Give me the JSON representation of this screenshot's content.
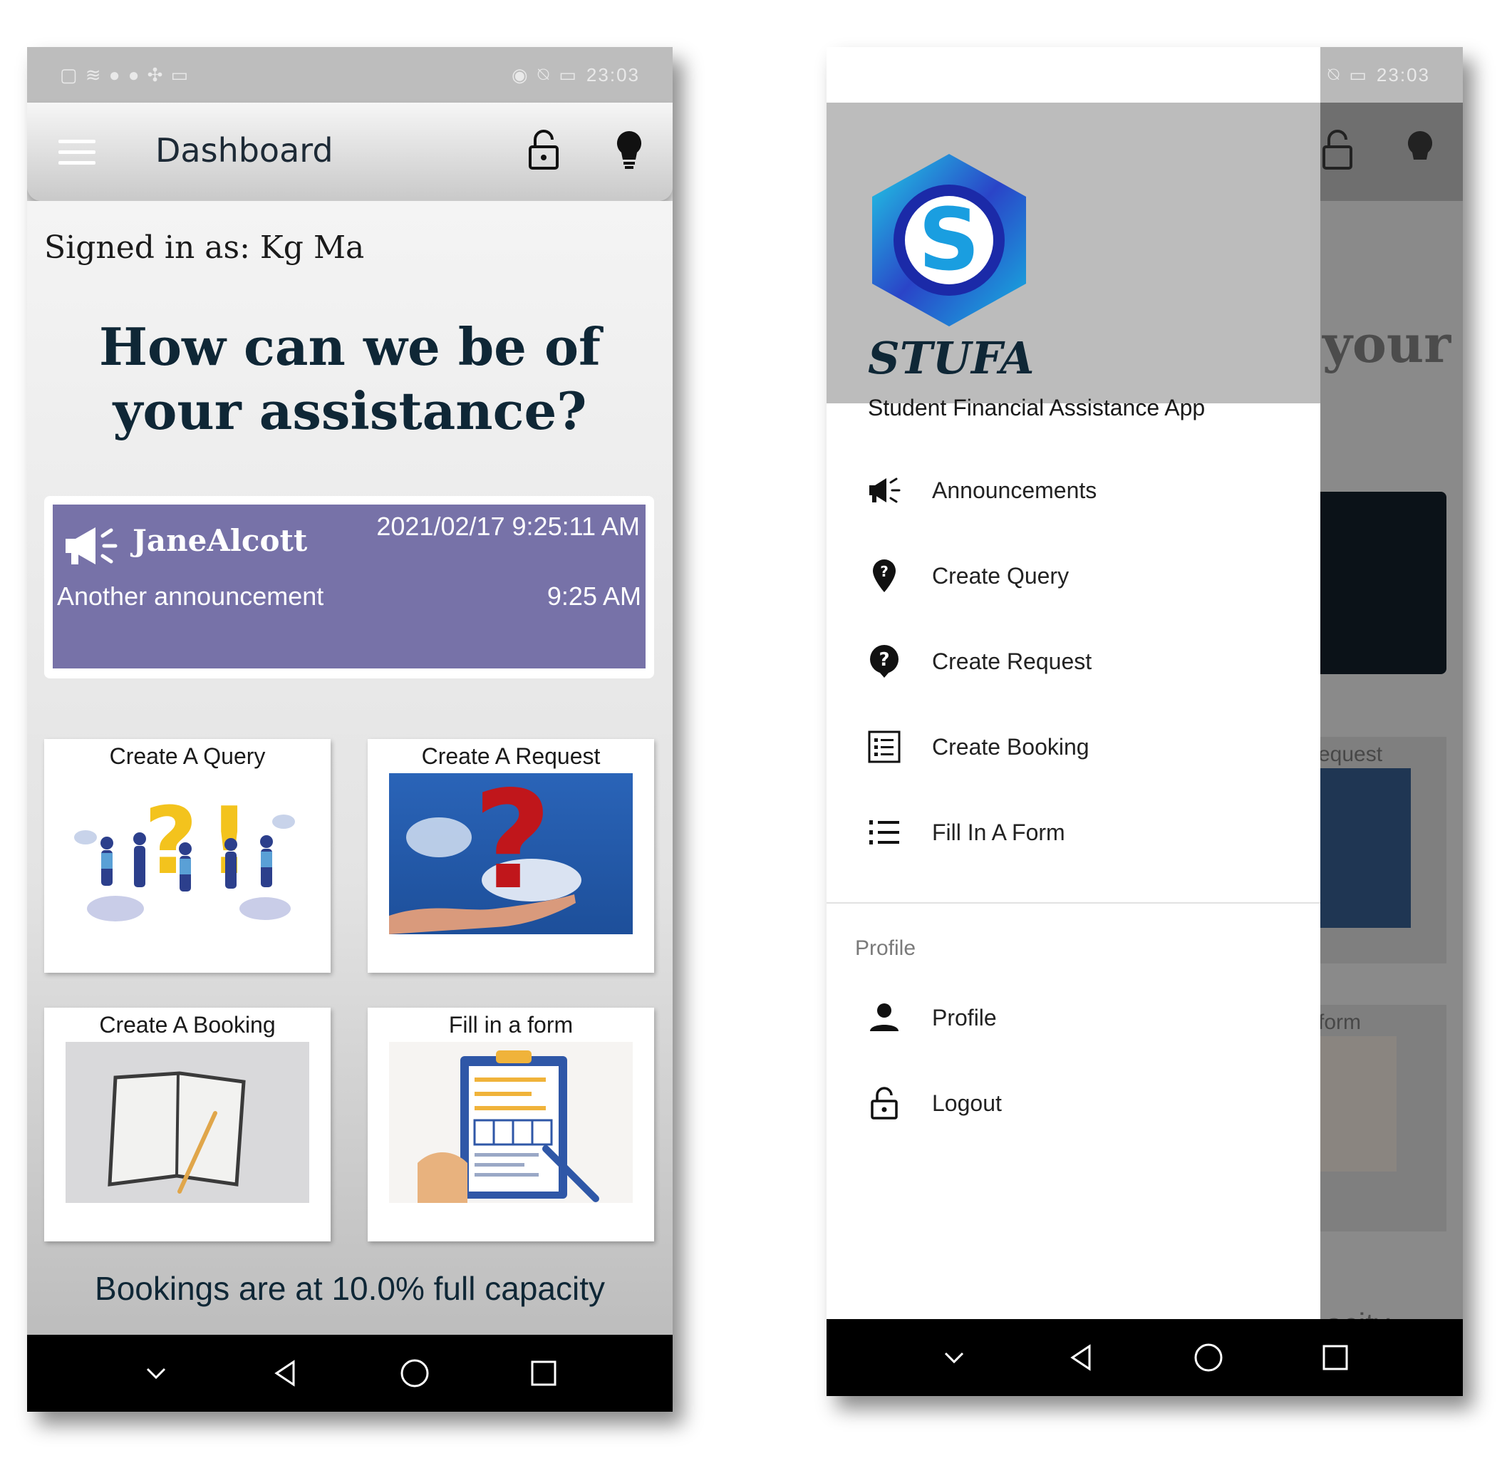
{
  "status_bar": {
    "time": "23:03"
  },
  "dashboard": {
    "title": "Dashboard",
    "signed_in": "Signed in as: Kg Ma",
    "headline": "How can we be of your assistance?",
    "announcement": {
      "author": "JaneAlcott",
      "date": "2021/02/17 9:25:11 AM",
      "message": "Another announcement",
      "time": "9:25 AM"
    },
    "cards": [
      {
        "title": "Create A Query"
      },
      {
        "title": "Create A Request"
      },
      {
        "title": "Create A Booking"
      },
      {
        "title": "Fill in a form"
      }
    ],
    "capacity": "Bookings are at 10.0% full capacity"
  },
  "drawer": {
    "brand": "STUFA",
    "tagline": "Student Financial Assistance App",
    "items": [
      {
        "label": "Announcements",
        "icon": "megaphone-icon"
      },
      {
        "label": "Create Query",
        "icon": "location-question-icon"
      },
      {
        "label": "Create Request",
        "icon": "question-circle-icon"
      },
      {
        "label": "Create Booking",
        "icon": "list-box-icon"
      },
      {
        "label": "Fill In A Form",
        "icon": "numbered-list-icon"
      }
    ],
    "section_label": "Profile",
    "profile_items": [
      {
        "label": "Profile",
        "icon": "person-icon"
      },
      {
        "label": "Logout",
        "icon": "lock-open-icon"
      }
    ],
    "peek": {
      "headline": "your",
      "card_request": "equest",
      "card_form": "form",
      "capacity": "acity"
    }
  },
  "colors": {
    "announcement_bg": "#7772a8",
    "title_color": "#0f2736",
    "drawer_header": "#bcbcbc"
  }
}
